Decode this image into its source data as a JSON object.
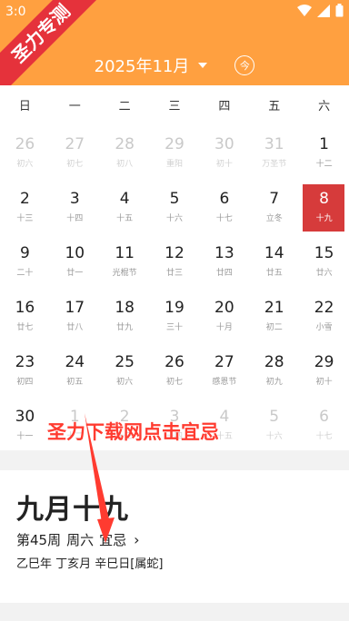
{
  "status": {
    "time": "3:0"
  },
  "banner": {
    "text": "圣力专测"
  },
  "header": {
    "month_label": "2025年11月",
    "today_label": "今"
  },
  "weekdays": [
    "日",
    "一",
    "二",
    "三",
    "四",
    "五",
    "六"
  ],
  "days": [
    {
      "d": "26",
      "l": "初六",
      "out": true
    },
    {
      "d": "27",
      "l": "初七",
      "out": true
    },
    {
      "d": "28",
      "l": "初八",
      "out": true
    },
    {
      "d": "29",
      "l": "重阳",
      "out": true
    },
    {
      "d": "30",
      "l": "初十",
      "out": true
    },
    {
      "d": "31",
      "l": "万圣节",
      "out": true
    },
    {
      "d": "1",
      "l": "十二"
    },
    {
      "d": "2",
      "l": "十三"
    },
    {
      "d": "3",
      "l": "十四"
    },
    {
      "d": "4",
      "l": "十五"
    },
    {
      "d": "5",
      "l": "十六"
    },
    {
      "d": "6",
      "l": "十七"
    },
    {
      "d": "7",
      "l": "立冬"
    },
    {
      "d": "8",
      "l": "十九",
      "sel": true
    },
    {
      "d": "9",
      "l": "二十"
    },
    {
      "d": "10",
      "l": "廿一"
    },
    {
      "d": "11",
      "l": "光棍节"
    },
    {
      "d": "12",
      "l": "廿三"
    },
    {
      "d": "13",
      "l": "廿四"
    },
    {
      "d": "14",
      "l": "廿五"
    },
    {
      "d": "15",
      "l": "廿六"
    },
    {
      "d": "16",
      "l": "廿七"
    },
    {
      "d": "17",
      "l": "廿八"
    },
    {
      "d": "18",
      "l": "廿九"
    },
    {
      "d": "19",
      "l": "三十"
    },
    {
      "d": "20",
      "l": "十月"
    },
    {
      "d": "21",
      "l": "初二"
    },
    {
      "d": "22",
      "l": "小雪"
    },
    {
      "d": "23",
      "l": "初四"
    },
    {
      "d": "24",
      "l": "初五"
    },
    {
      "d": "25",
      "l": "初六"
    },
    {
      "d": "26",
      "l": "初七"
    },
    {
      "d": "27",
      "l": "感恩节"
    },
    {
      "d": "28",
      "l": "初九"
    },
    {
      "d": "29",
      "l": "初十"
    },
    {
      "d": "30",
      "l": "十一"
    },
    {
      "d": "1",
      "l": "十二",
      "out": true
    },
    {
      "d": "2",
      "l": "十三",
      "out": true
    },
    {
      "d": "3",
      "l": "十四",
      "out": true
    },
    {
      "d": "4",
      "l": "十五",
      "out": true
    },
    {
      "d": "5",
      "l": "十六",
      "out": true
    },
    {
      "d": "6",
      "l": "十七",
      "out": true
    }
  ],
  "detail": {
    "big_date": "九月十九",
    "week_label": "第45周",
    "weekday_label": "周六",
    "yiji_label": "宜忌",
    "ganzhi": "乙巳年 丁亥月 辛巳日[属蛇]"
  },
  "watermark": {
    "text": "圣力下载网点击宜忌"
  },
  "colors": {
    "header": "#ffa040",
    "selected": "#d63b3b",
    "banner": "#e5323b"
  }
}
